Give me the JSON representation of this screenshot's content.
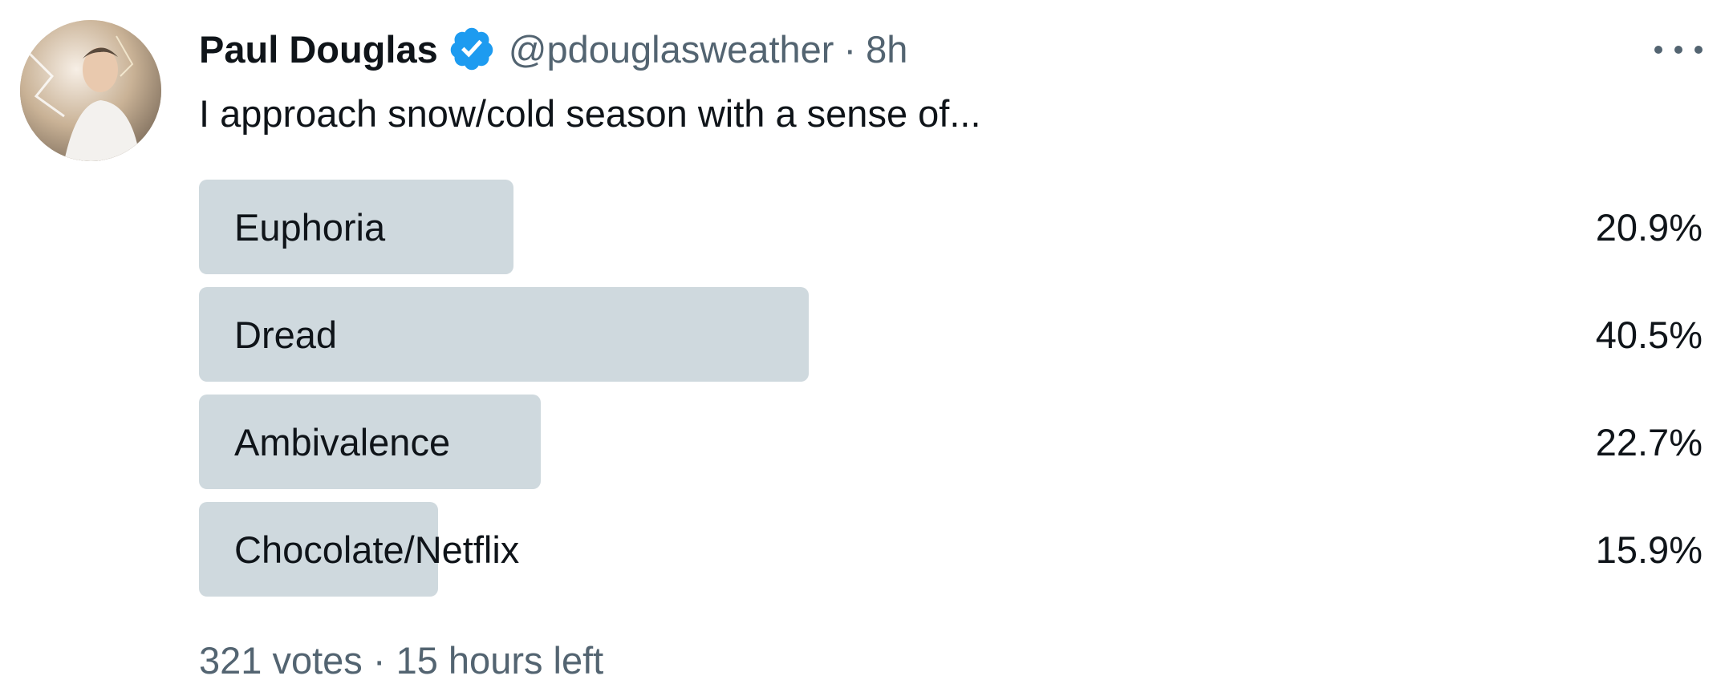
{
  "author": {
    "display_name": "Paul Douglas",
    "handle": "@pdouglasweather",
    "separator": "·",
    "time": "8h",
    "verified": true,
    "verified_color": "#1d9bf0",
    "avatar_icon": "profile-avatar"
  },
  "tweet": {
    "text": "I approach snow/cold season with a sense of..."
  },
  "poll": {
    "options": [
      {
        "label": "Euphoria",
        "percent_text": "20.9%",
        "percent": 20.9
      },
      {
        "label": "Dread",
        "percent_text": "40.5%",
        "percent": 40.5
      },
      {
        "label": "Ambivalence",
        "percent_text": "22.7%",
        "percent": 22.7
      },
      {
        "label": "Chocolate/Netflix",
        "percent_text": "15.9%",
        "percent": 15.9
      }
    ],
    "meta": "321 votes · 15 hours left",
    "bar_color": "#cfd9de"
  },
  "colors": {
    "text_primary": "#0f1419",
    "text_secondary": "#536471"
  }
}
